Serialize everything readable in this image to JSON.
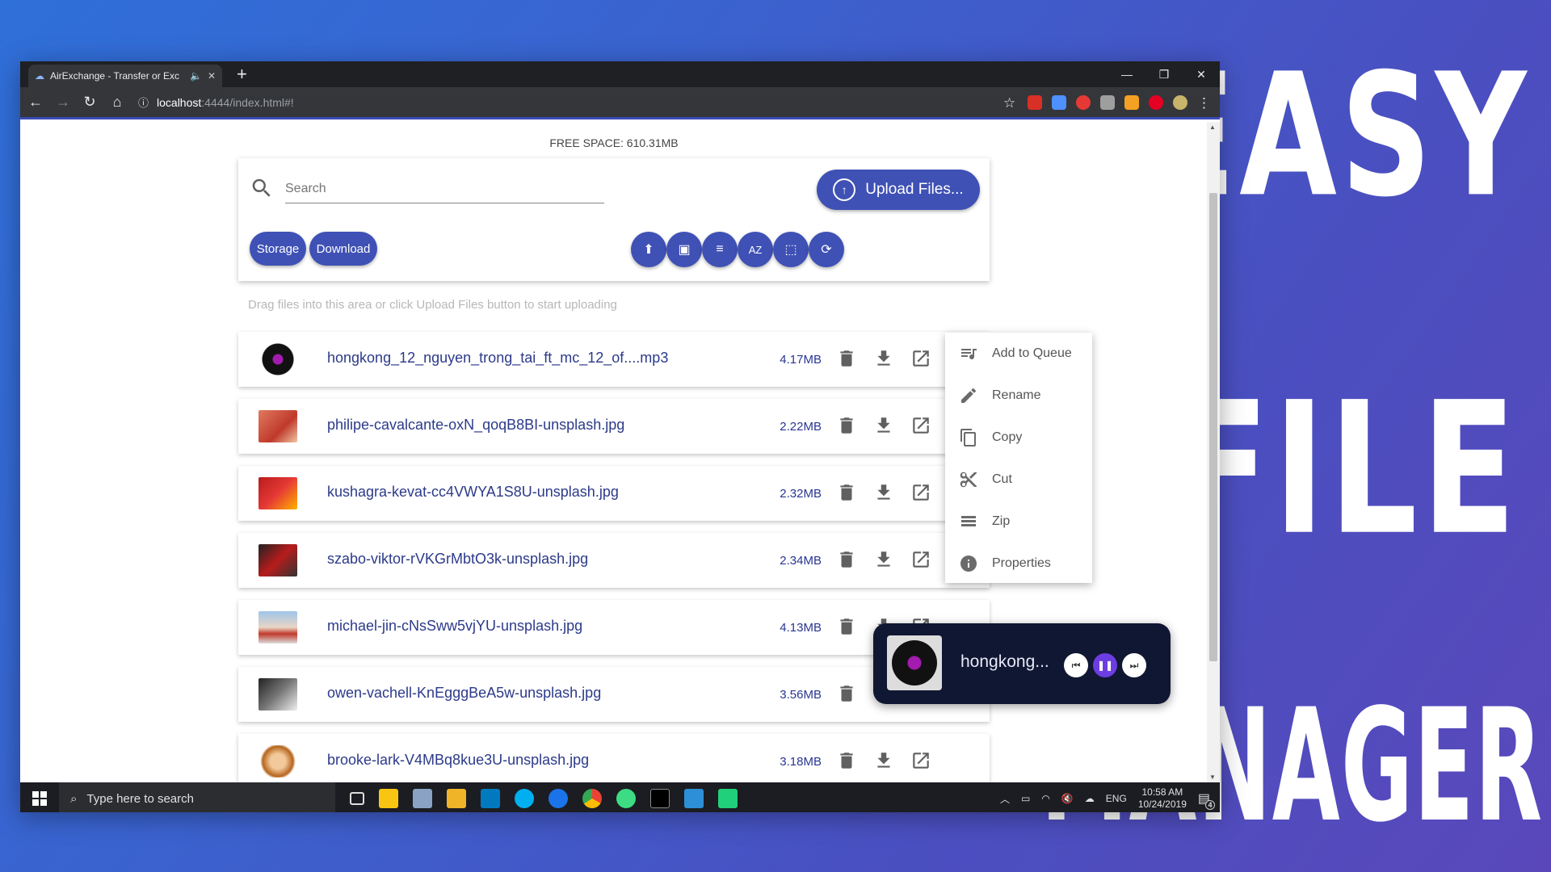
{
  "headline": {
    "line1": "EASY",
    "line2": "FILE",
    "line3": "MANAGER"
  },
  "browser": {
    "tab_title": "AirExchange - Transfer or Exc",
    "new_tab": "+",
    "url_host": "localhost",
    "url_path": ":4444/index.html#!"
  },
  "page": {
    "free_space": "FREE SPACE: 610.31MB",
    "search_placeholder": "Search",
    "upload_label": "Upload Files...",
    "storage_label": "Storage",
    "download_label": "Download",
    "drag_hint": "Drag files into this area or click Upload Files button to start uploading"
  },
  "files": [
    {
      "name": "hongkong_12_nguyen_trong_tai_ft_mc_12_of....mp3",
      "size": "4.17MB"
    },
    {
      "name": "philipe-cavalcante-oxN_qoqB8BI-unsplash.jpg",
      "size": "2.22MB"
    },
    {
      "name": "kushagra-kevat-cc4VWYA1S8U-unsplash.jpg",
      "size": "2.32MB"
    },
    {
      "name": "szabo-viktor-rVKGrMbtO3k-unsplash.jpg",
      "size": "2.34MB"
    },
    {
      "name": "michael-jin-cNsSww5vjYU-unsplash.jpg",
      "size": "4.13MB"
    },
    {
      "name": "owen-vachell-KnEgggBeA5w-unsplash.jpg",
      "size": "3.56MB"
    },
    {
      "name": "brooke-lark-V4MBq8kue3U-unsplash.jpg",
      "size": "3.18MB"
    }
  ],
  "context_menu": {
    "items": [
      "Add to Queue",
      "Rename",
      "Copy",
      "Cut",
      "Zip",
      "Properties"
    ]
  },
  "player": {
    "title": "hongkong..."
  },
  "taskbar": {
    "search_placeholder": "Type here to search",
    "language": "ENG",
    "time": "10:58 AM",
    "date": "10/24/2019",
    "notifications": "4"
  },
  "colors": {
    "primary": "#3f51b5",
    "player_bg": "#101733",
    "accent_purple": "#a21caf"
  }
}
